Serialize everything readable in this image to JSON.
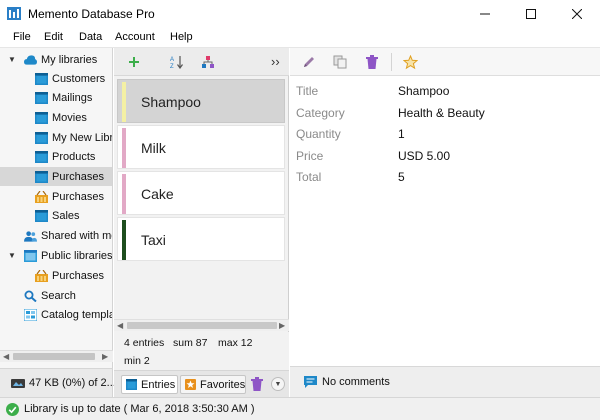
{
  "window": {
    "title": "Memento Database Pro"
  },
  "menu": [
    "File",
    "Edit",
    "Data",
    "Account",
    "Help"
  ],
  "sidebar": {
    "root_label": "My libraries",
    "libraries": [
      "Customers",
      "Mailings",
      "Movies",
      "My New Libr...",
      "Products",
      "Purchases",
      "Purchases",
      "Sales"
    ],
    "shared_label": "Shared with me",
    "public_label": "Public libraries",
    "public_item": "Purchases",
    "search_label": "Search",
    "catalog_label": "Catalog templa...",
    "storage_text": "47 KB (0%) of 2..."
  },
  "list": {
    "entries": [
      {
        "name": "Shampoo",
        "color": "#f4f0a4"
      },
      {
        "name": "Milk",
        "color": "#e2a9c6"
      },
      {
        "name": "Cake",
        "color": "#e2a9c6"
      },
      {
        "name": "Taxi",
        "color": "#1d4d1d"
      }
    ],
    "stats": {
      "entries": "4 entries",
      "sum": "sum 87",
      "max": "max 12",
      "min": "min 2"
    },
    "tab_entries": "Entries",
    "tab_favorites": "Favorites",
    "more_label": "››"
  },
  "detail": {
    "fields": [
      {
        "label": "Title",
        "value": "Shampoo"
      },
      {
        "label": "Category",
        "value": "Health & Beauty"
      },
      {
        "label": "Quantity",
        "value": "1"
      },
      {
        "label": "Price",
        "value": "USD 5.00"
      },
      {
        "label": "Total",
        "value": "5"
      }
    ],
    "comments": "No comments"
  },
  "status": {
    "text": "Library is up to date ( Mar 6, 2018 3:50:30 AM )"
  },
  "colors": {
    "accent_blue": "#1e88c8",
    "add_green": "#3cae4a",
    "delete_purple": "#8e55c6",
    "star": "#e0a020"
  }
}
